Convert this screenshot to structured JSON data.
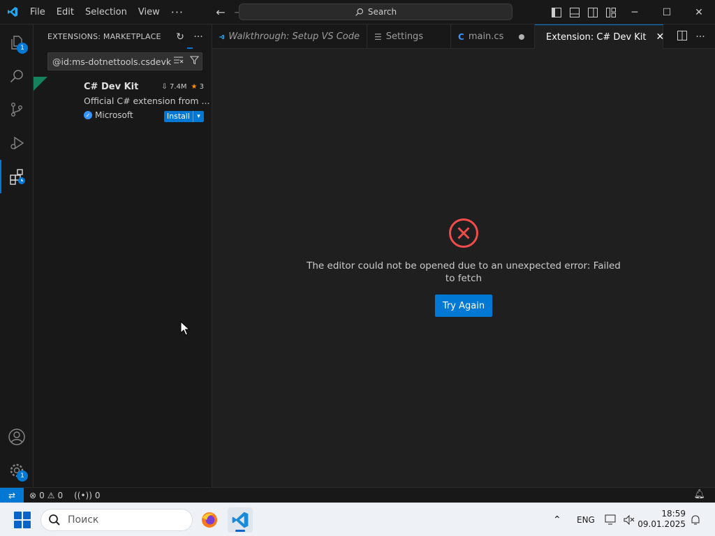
{
  "titlebar": {
    "menu": [
      "File",
      "Edit",
      "Selection",
      "View"
    ],
    "more": "···",
    "search_label": "Search"
  },
  "activity": {
    "explorer_badge": "1",
    "settings_badge": "1"
  },
  "sidebar": {
    "title": "EXTENSIONS: MARKETPLACE",
    "search_value": "@id:ms-dotnettools.csdevkit",
    "extension": {
      "name": "C# Dev Kit",
      "downloads": "7.4M",
      "rating": "3",
      "description": "Official C# extension from ...",
      "publisher": "Microsoft",
      "install_label": "Install"
    }
  },
  "tabs": [
    {
      "label": "Walkthrough: Setup VS Code",
      "icon": "vscode-icon",
      "italic": true
    },
    {
      "label": "Settings",
      "icon": "settings-icon"
    },
    {
      "label": "main.cs",
      "icon": "csharp-icon",
      "modified": true
    },
    {
      "label": "Extension: C# Dev Kit",
      "icon": "extensions-icon",
      "active": true
    }
  ],
  "editor": {
    "error_message": "The editor could not be opened due to an unexpected error: Failed to fetch",
    "try_again_label": "Try Again"
  },
  "statusbar": {
    "errors": "0",
    "warnings": "0",
    "ports": "0"
  },
  "taskbar": {
    "search_placeholder": "Поиск",
    "language": "ENG",
    "time": "18:59",
    "date": "09.01.2025"
  },
  "colors": {
    "accent": "#0078d4",
    "error": "#f14c4c",
    "background": "#1f1f1f",
    "sidebar_background": "#181818"
  }
}
